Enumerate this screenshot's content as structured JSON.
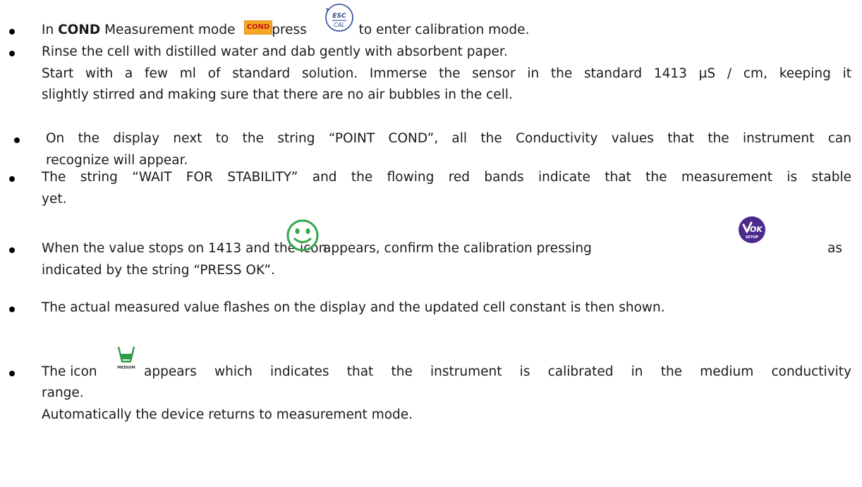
{
  "items": [
    {
      "pre": "In ",
      "bold": "COND",
      "mid1": " Measurement mode ",
      "mid2": " press ",
      "post": " to enter calibration mode."
    },
    {
      "lines": [
        "Rinse the cell with distilled water and dab gently with absorbent paper.",
        "Start with a few ml of standard solution. Immerse the sensor in the standard 1413 µS / cm, keeping it",
        "slightly stirred and making sure that there are no air bubbles in the cell."
      ]
    },
    {
      "lines": [
        "On the display next to the string “POINT COND”, all the Conductivity values that the instrument can",
        "recognize will appear."
      ]
    },
    {
      "lines": [
        "The string “WAIT FOR STABILITY” and the flowing red bands indicate that the measurement is stable",
        "yet."
      ]
    },
    {
      "pre": "When the value stops on 1413 and the icon",
      "mid": "appears, confirm the calibration pressing",
      "post": "as",
      "line2": "indicated by the string “PRESS OK”."
    },
    {
      "lines": [
        "The actual measured value flashes on the display and the updated cell constant is then shown."
      ]
    },
    {
      "pre": "The icon",
      "post": "appears which indicates that the instrument is calibrated in the medium conductivity",
      "line2": "range.",
      "line3": "Automatically the device returns to measurement mode."
    }
  ],
  "icons": {
    "cond_key": "COND",
    "esc_key_top": "ESC",
    "esc_key_bottom": "CAL",
    "ok_key_top": "OK",
    "ok_key_bottom": "SETUP",
    "medium_label": "MEDIUM"
  },
  "colors": {
    "cond_orange": "#f7a823",
    "cond_text": "#c41a1a",
    "esc_blue": "#2a4a8f",
    "smiley_green": "#34a84a",
    "ok_purple": "#4b2a8c",
    "medium_green": "#2e9a48"
  }
}
